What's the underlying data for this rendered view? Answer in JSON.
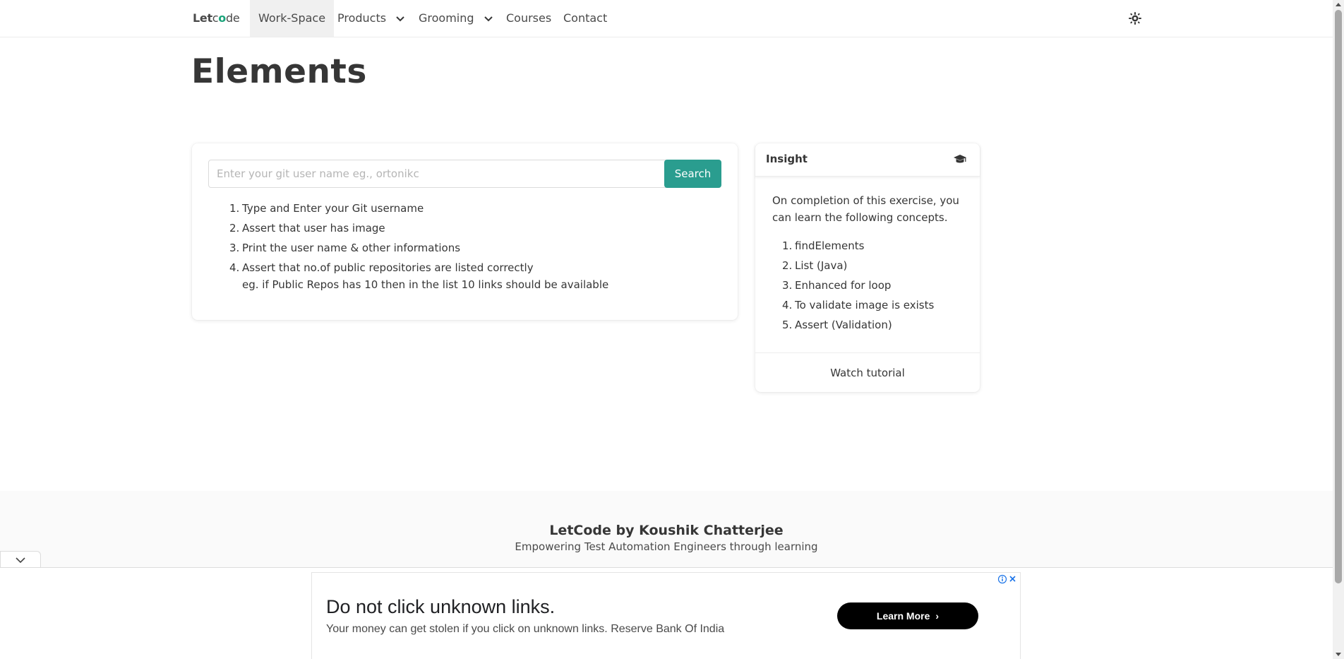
{
  "nav": {
    "brand": {
      "part1": "Let",
      "part2": "c",
      "part3": "o",
      "part4": "de"
    },
    "items": [
      {
        "label": "Work-Space"
      },
      {
        "label": "Products"
      },
      {
        "label": "Grooming"
      },
      {
        "label": "Courses"
      },
      {
        "label": "Contact"
      }
    ]
  },
  "page": {
    "title": "Elements"
  },
  "search": {
    "placeholder": "Enter your git user name eg., ortonikc",
    "value": "",
    "button_label": "Search"
  },
  "steps": [
    {
      "num": "1.",
      "text": "Type and Enter your Git username",
      "sub": ""
    },
    {
      "num": "2.",
      "text": "Assert that user has image",
      "sub": ""
    },
    {
      "num": "3.",
      "text": "Print the user name & other informations",
      "sub": ""
    },
    {
      "num": "4.",
      "text": "Assert that no.of public repositories are listed correctly",
      "sub": "eg. if Public Repos has 10 then in the list 10 links should be available"
    }
  ],
  "insight": {
    "title": "Insight",
    "description": "On completion of this exercise, you can learn the following concepts.",
    "concepts": [
      {
        "num": "1.",
        "text": "findElements"
      },
      {
        "num": "2.",
        "text": "List (Java)"
      },
      {
        "num": "3.",
        "text": "Enhanced for loop"
      },
      {
        "num": "4.",
        "text": "To validate image is exists"
      },
      {
        "num": "5.",
        "text": "Assert (Validation)"
      }
    ],
    "footer_link": "Watch tutorial"
  },
  "footer": {
    "title": "LetCode by Koushik Chatterjee",
    "subtitle": "Empowering Test Automation Engineers through learning"
  },
  "ad": {
    "headline": "Do not click unknown links.",
    "body": "Your money can get stolen if you click on unknown links. Reserve Bank Of India",
    "cta": "Learn More"
  },
  "colors": {
    "accent": "#2a9d8f",
    "brand_green": "#1aa37a",
    "text": "#363636",
    "footer_bg": "#fafafa"
  },
  "icons": {
    "theme": "sun-gear-icon",
    "insight": "graduation-cap-icon",
    "dropdown": "chevron-down-icon",
    "ad_choices": "adchoices-icon",
    "ad_close": "close-icon",
    "collapse": "chevron-down-icon"
  }
}
